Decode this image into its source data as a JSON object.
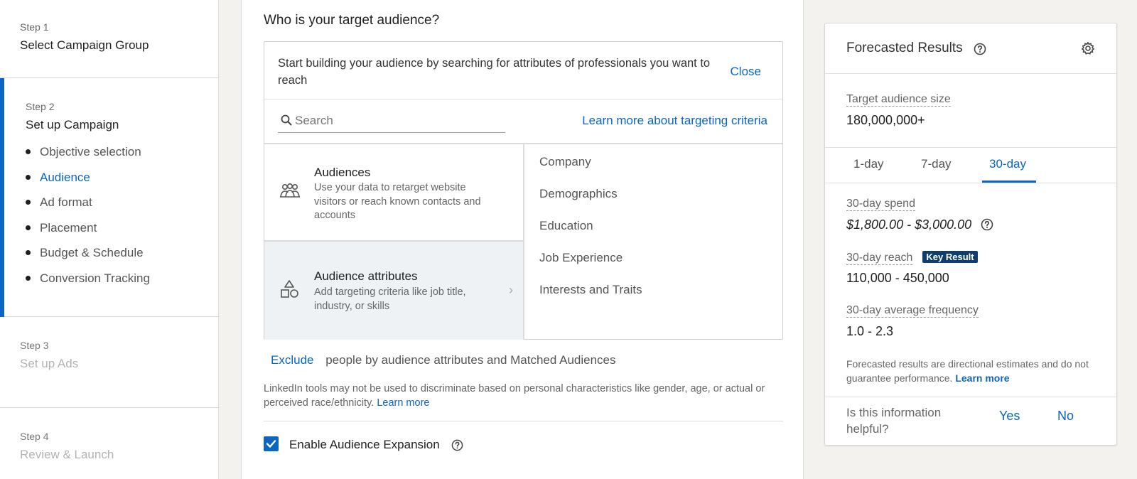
{
  "sidebar": {
    "steps": [
      {
        "num": "Step 1",
        "title": "Select Campaign Group"
      },
      {
        "num": "Step 2",
        "title": "Set up Campaign"
      },
      {
        "num": "Step 3",
        "title": "Set up Ads"
      },
      {
        "num": "Step 4",
        "title": "Review & Launch"
      }
    ],
    "substeps": [
      "Objective selection",
      "Audience",
      "Ad format",
      "Placement",
      "Budget & Schedule",
      "Conversion Tracking"
    ],
    "active_substep": "Audience",
    "accent_color": "#0a66c2"
  },
  "main": {
    "heading": "Who is your target audience?",
    "intro": "Start building your audience by searching for attributes of professionals you want to reach",
    "close_label": "Close",
    "search_placeholder": "Search",
    "learn_more_targeting": "Learn more about targeting criteria",
    "options": [
      {
        "title": "Audiences",
        "desc": "Use your data to retarget website visitors or reach known contacts and accounts",
        "icon": "people-group-icon"
      },
      {
        "title": "Audience attributes",
        "desc": "Add targeting criteria like job title, industry, or skills",
        "icon": "shapes-icon"
      }
    ],
    "categories": [
      "Company",
      "Demographics",
      "Education",
      "Job Experience",
      "Interests and Traits"
    ],
    "exclude_label": "Exclude",
    "exclude_text": "people by audience attributes and Matched Audiences",
    "disclaimer": "LinkedIn tools may not be used to discriminate based on personal characteristics like gender, age, or actual or perceived race/ethnicity.",
    "disclaimer_link": "Learn more",
    "expansion_label": "Enable Audience Expansion",
    "expansion_checked": true
  },
  "forecast": {
    "title": "Forecasted Results",
    "audience_size_label": "Target audience size",
    "audience_size_value": "180,000,000+",
    "tabs": [
      "1-day",
      "7-day",
      "30-day"
    ],
    "active_tab": "30-day",
    "spend_label": "30-day spend",
    "spend_value": "$1,800.00 - $3,000.00",
    "reach_label": "30-day reach",
    "key_result_badge": "Key Result",
    "reach_value": "110,000 - 450,000",
    "frequency_label": "30-day average frequency",
    "frequency_value": "1.0 - 2.3",
    "note": "Forecasted results are directional estimates and do not guarantee performance.",
    "note_link": "Learn more",
    "helpful_question": "Is this information helpful?",
    "yes_label": "Yes",
    "no_label": "No"
  }
}
